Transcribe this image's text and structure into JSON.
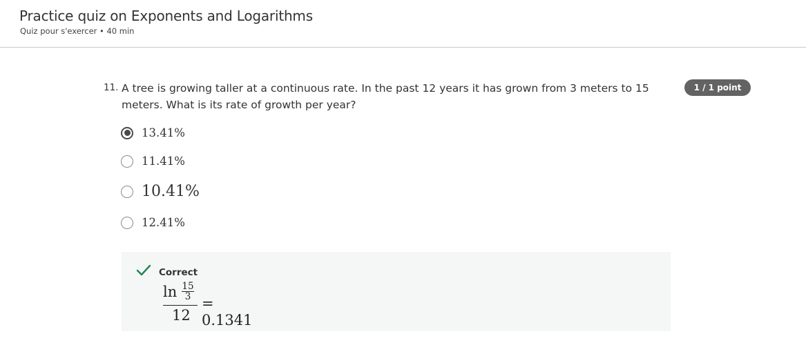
{
  "header": {
    "title": "Practice quiz on Exponents and Logarithms",
    "meta": "Quiz pour s'exercer • 40 min"
  },
  "question": {
    "number": "11.",
    "text": "A tree is growing taller at a continuous rate. In the past 12 years it has grown from 3 meters to 15 meters. What is its rate of growth per year?",
    "points": "1 / 1 point",
    "options": [
      {
        "label": "13.41%",
        "selected": true
      },
      {
        "label": "11.41%",
        "selected": false
      },
      {
        "label": "10.41%",
        "selected": false
      },
      {
        "label": "12.41%",
        "selected": false
      }
    ]
  },
  "feedback": {
    "status": "Correct",
    "status_color": "#1f8354",
    "formula": {
      "ln": "ln",
      "inner_numerator": "15",
      "inner_denominator": "3",
      "denominator": "12",
      "result": "= 0.1341"
    }
  },
  "icons": {
    "selected_radio": "radio-checked-icon",
    "unselected_radio": "radio-unchecked-icon",
    "status": "checkmark-icon"
  }
}
